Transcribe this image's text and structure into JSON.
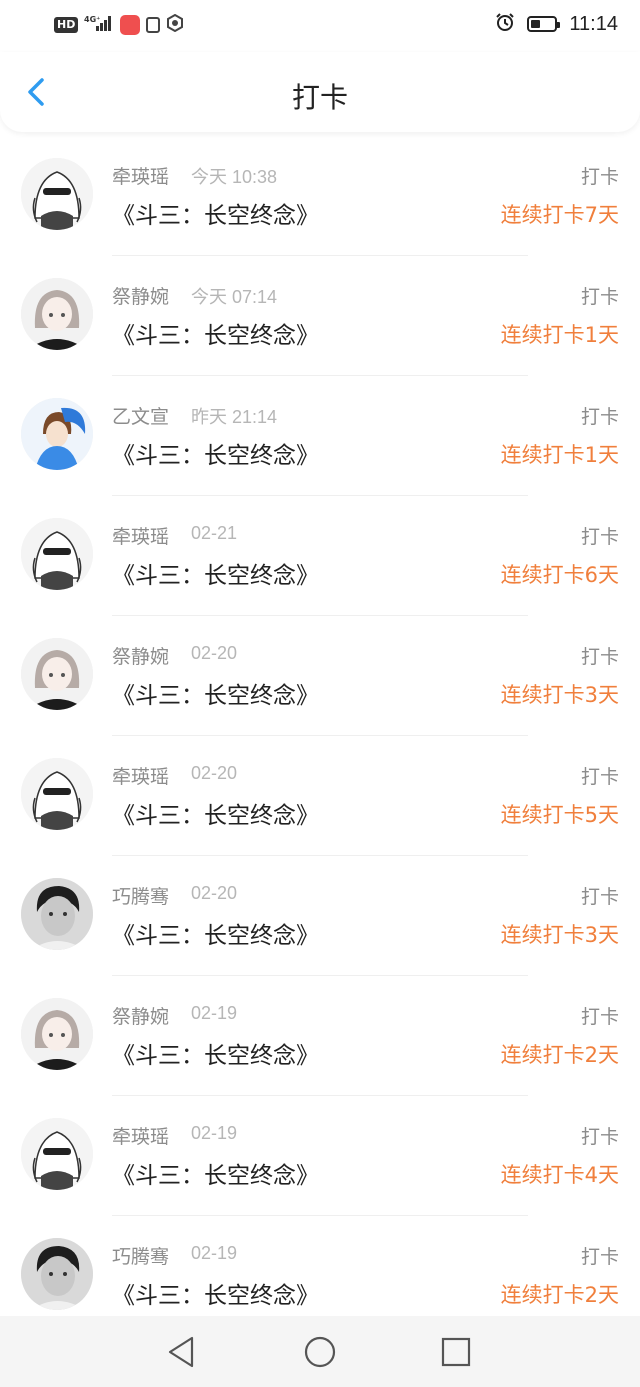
{
  "status_bar": {
    "hd": "HD",
    "network": "4G⁺",
    "time": "11:14",
    "battery_level": 0.35
  },
  "header": {
    "title": "打卡"
  },
  "colors": {
    "accent": "#2f9cf0",
    "streak": "#f07f3c",
    "muted": "#8c8c8c"
  },
  "rows": [
    {
      "name": "牵瑛瑶",
      "time": "今天 10:38",
      "book": "《斗三：长空终念》",
      "action": "打卡",
      "streak": "连续打卡7天",
      "avatar": "anime-girl-sunglasses"
    },
    {
      "name": "祭静婉",
      "time": "今天 07:14",
      "book": "《斗三：长空终念》",
      "action": "打卡",
      "streak": "连续打卡1天",
      "avatar": "anime-girl-bob"
    },
    {
      "name": "乙文宣",
      "time": "昨天 21:14",
      "book": "《斗三：长空终念》",
      "action": "打卡",
      "streak": "连续打卡1天",
      "avatar": "anime-boy-blue"
    },
    {
      "name": "牵瑛瑶",
      "time": "02-21",
      "book": "《斗三：长空终念》",
      "action": "打卡",
      "streak": "连续打卡6天",
      "avatar": "anime-girl-sunglasses"
    },
    {
      "name": "祭静婉",
      "time": "02-20",
      "book": "《斗三：长空终念》",
      "action": "打卡",
      "streak": "连续打卡3天",
      "avatar": "anime-girl-bob"
    },
    {
      "name": "牵瑛瑶",
      "time": "02-20",
      "book": "《斗三：长空终念》",
      "action": "打卡",
      "streak": "连续打卡5天",
      "avatar": "anime-girl-sunglasses"
    },
    {
      "name": "巧腾骞",
      "time": "02-20",
      "book": "《斗三：长空终念》",
      "action": "打卡",
      "streak": "连续打卡3天",
      "avatar": "photo-boy"
    },
    {
      "name": "祭静婉",
      "time": "02-19",
      "book": "《斗三：长空终念》",
      "action": "打卡",
      "streak": "连续打卡2天",
      "avatar": "anime-girl-bob"
    },
    {
      "name": "牵瑛瑶",
      "time": "02-19",
      "book": "《斗三：长空终念》",
      "action": "打卡",
      "streak": "连续打卡4天",
      "avatar": "anime-girl-sunglasses"
    },
    {
      "name": "巧腾骞",
      "time": "02-19",
      "book": "《斗三：长空终念》",
      "action": "打卡",
      "streak": "连续打卡2天",
      "avatar": "photo-boy"
    }
  ],
  "nav_bar": {
    "buttons": [
      "back-icon",
      "home-icon",
      "recents-icon"
    ]
  }
}
